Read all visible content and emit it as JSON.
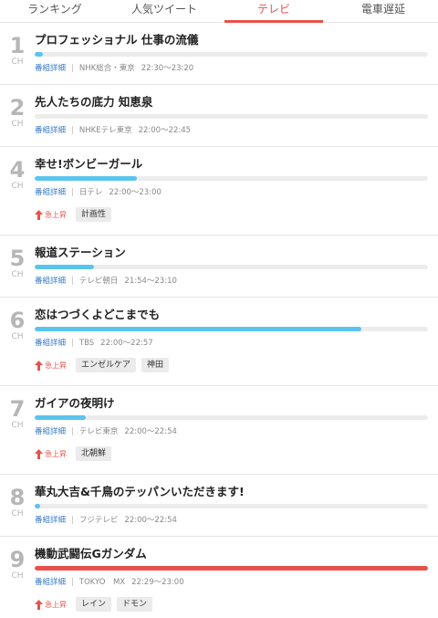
{
  "tabs": [
    {
      "label": "ランキング",
      "active": false
    },
    {
      "label": "人気ツイート",
      "active": false
    },
    {
      "label": "テレビ",
      "active": true
    },
    {
      "label": "電車遅延",
      "active": false
    }
  ],
  "colors": {
    "accent": "#e8514a",
    "bar_blue": "#5bc4ee",
    "bar_bg": "#ececec",
    "detail_link": "#3a7bc8"
  },
  "detail_label": "番組詳細",
  "rising_label": "急上昇",
  "ch_unit": "CH",
  "programs": [
    {
      "ch": "1",
      "title": "プロフェッショナル 仕事の流儀",
      "progress": 0.02,
      "bar_color": "blue",
      "station": "NHK総合・東京",
      "time": "22:30〜23:20",
      "rising": false,
      "tags": []
    },
    {
      "ch": "2",
      "title": "先人たちの底力 知恵泉",
      "progress": 0.0,
      "bar_color": "blue",
      "station": "NHKEテレ東京",
      "time": "22:00〜22:45",
      "rising": false,
      "tags": []
    },
    {
      "ch": "4",
      "title": "幸せ!ボンビーガール",
      "progress": 0.26,
      "bar_color": "blue",
      "station": "日テレ",
      "time": "22:00〜23:00",
      "rising": true,
      "tags": [
        "計画性"
      ]
    },
    {
      "ch": "5",
      "title": "報道ステーション",
      "progress": 0.15,
      "bar_color": "blue",
      "station": "テレビ朝日",
      "time": "21:54〜23:10",
      "rising": false,
      "tags": []
    },
    {
      "ch": "6",
      "title": "恋はつづくよどこまでも",
      "progress": 0.83,
      "bar_color": "blue",
      "station": "TBS",
      "time": "22:00〜22:57",
      "rising": true,
      "tags": [
        "エンゼルケア",
        "神田"
      ]
    },
    {
      "ch": "7",
      "title": "ガイアの夜明け",
      "progress": 0.13,
      "bar_color": "blue",
      "station": "テレビ東京",
      "time": "22:00〜22:54",
      "rising": true,
      "tags": [
        "北朝鮮"
      ]
    },
    {
      "ch": "8",
      "title": "華丸大吉&千鳥のテッパンいただきます!",
      "progress": 0.01,
      "bar_color": "blue",
      "station": "フジテレビ",
      "time": "22:00〜22:54",
      "rising": false,
      "tags": []
    },
    {
      "ch": "9",
      "title": "機動武闘伝Gガンダム",
      "progress": 1.0,
      "bar_color": "red",
      "station": "TOKYO　MX",
      "time": "22:29〜23:00",
      "rising": true,
      "tags": [
        "レイン",
        "ドモン"
      ]
    }
  ]
}
